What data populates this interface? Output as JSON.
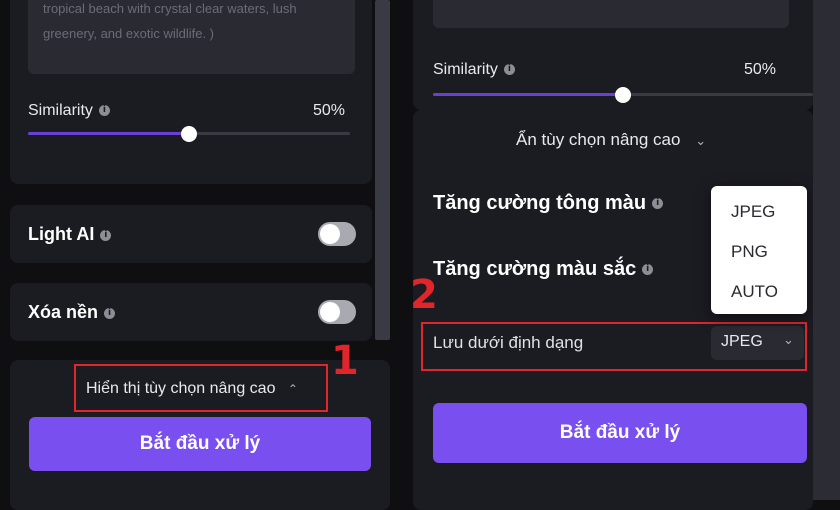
{
  "left": {
    "prompt_text_line1": "tropical beach with crystal clear waters, lush",
    "prompt_text_line2": "greenery, and exotic wildlife. )",
    "similarity_label": "Similarity",
    "similarity_value": "50%",
    "similarity_fraction": 0.5,
    "light_ai_label": "Light AI",
    "remove_bg_label": "Xóa nền",
    "advanced_toggle_label": "Hiển thị tùy chọn nâng cao",
    "advanced_chevron": "⌃",
    "start_button_label": "Bắt đầu xử lý",
    "step_number": "1"
  },
  "right": {
    "similarity_label": "Similarity",
    "similarity_value": "50%",
    "similarity_fraction": 0.5,
    "advanced_toggle_label": "Ẩn tùy chọn nâng cao",
    "advanced_chevron": "⌄",
    "tone_label": "Tăng cường tông màu",
    "color_label": "Tăng cường màu sắc",
    "save_format_label": "Lưu dưới định dạng",
    "save_format_value": "JPEG",
    "select_chevron": "⌄",
    "format_options": [
      "JPEG",
      "PNG",
      "AUTO"
    ],
    "start_button_label": "Bắt đầu xử lý",
    "step_number": "2"
  },
  "info_glyph": "i",
  "colors": {
    "accent": "#7a4ff0",
    "slider": "#6a3fd6",
    "highlight": "#e0262a",
    "panel": "#1b1b22"
  }
}
